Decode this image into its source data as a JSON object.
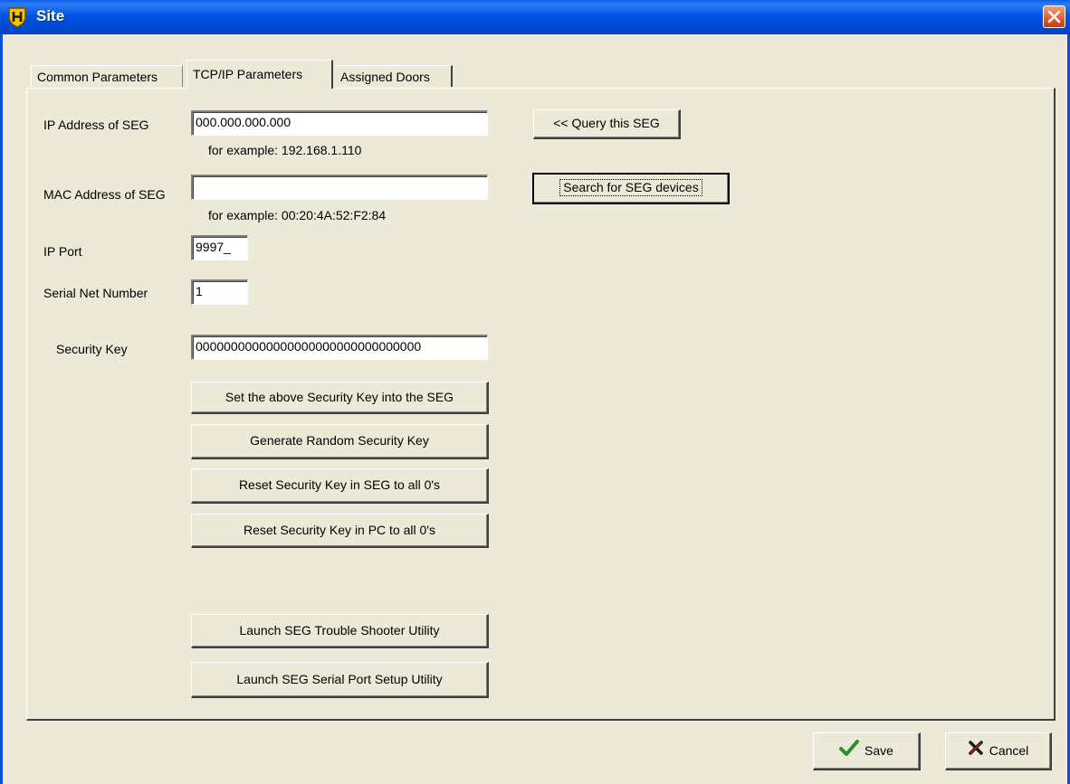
{
  "window": {
    "title": "Site",
    "app_icon": "shield-h-icon",
    "close_icon": "close-icon"
  },
  "tabs": [
    {
      "label": "Common Parameters",
      "active": false
    },
    {
      "label": "TCP/IP Parameters",
      "active": true
    },
    {
      "label": "Assigned Doors",
      "active": false
    }
  ],
  "form": {
    "ip_address": {
      "label": "IP Address of SEG",
      "value": "000.000.000.000",
      "hint": "for example: 192.168.1.110"
    },
    "mac_address": {
      "label": "MAC Address of SEG",
      "value": "",
      "hint": "for example: 00:20:4A:52:F2:84"
    },
    "ip_port": {
      "label": "IP Port",
      "value": "9997_"
    },
    "serial_net": {
      "label": "Serial Net Number",
      "value": "1"
    },
    "security_key": {
      "label": "Security Key",
      "value": "00000000000000000000000000000000"
    }
  },
  "buttons": {
    "query_seg": "<< Query this SEG",
    "search_seg": "Search for SEG devices",
    "set_key": "Set the above Security Key into the SEG",
    "generate_key": "Generate Random Security Key",
    "reset_seg_key": "Reset Security Key in SEG to all 0's",
    "reset_pc_key": "Reset Security Key in PC to all 0's",
    "trouble_shooter": "Launch SEG Trouble Shooter Utility",
    "serial_setup": "Launch SEG Serial Port Setup Utility",
    "save": "Save",
    "cancel": "Cancel"
  },
  "icons": {
    "save": "checkmark-icon",
    "cancel": "x-icon"
  },
  "colors": {
    "titlebar": "#0055E5",
    "dialog_bg": "#ECE9D8",
    "save_check": "#2E8B2E",
    "cancel_x": "#1A1A1A"
  }
}
